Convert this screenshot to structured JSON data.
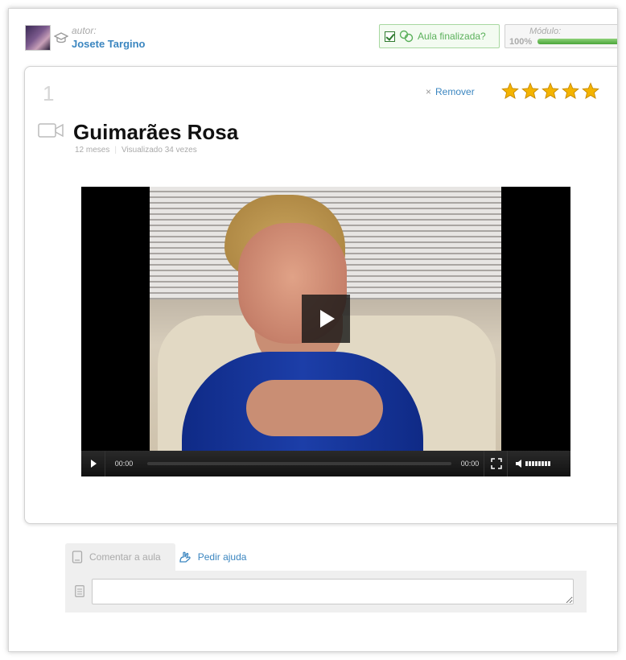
{
  "header": {
    "author_label": "autor:",
    "author_name": "Josete Targino",
    "finalize_label": "Aula finalizada?",
    "module_label": "Módulo:",
    "module_progress_text": "100%",
    "module_progress": 1.0
  },
  "lesson": {
    "number": "1",
    "remove_label": "Remover",
    "rating": 5,
    "title": "Guimarães Rosa",
    "age": "12 meses",
    "views": "Visualizado 34 vezes"
  },
  "player": {
    "current_time": "00:00",
    "duration": "00:00"
  },
  "comments": {
    "tabs": [
      {
        "label": "Comentar a aula"
      },
      {
        "label": "Pedir ajuda"
      }
    ],
    "input_value": ""
  },
  "colors": {
    "link": "#3b86c0",
    "success": "#5ab05a",
    "star": "#f4b400"
  }
}
